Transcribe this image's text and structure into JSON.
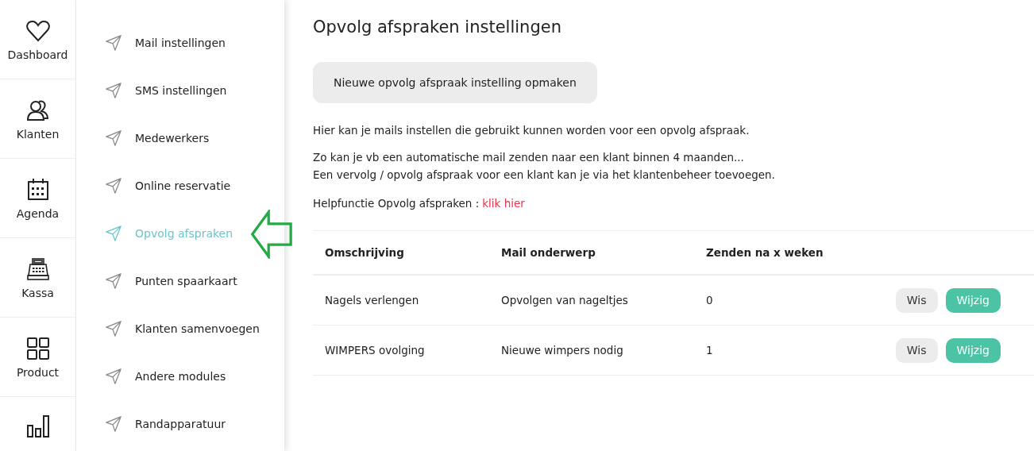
{
  "nav": [
    {
      "label": "Dashboard"
    },
    {
      "label": "Klanten"
    },
    {
      "label": "Agenda"
    },
    {
      "label": "Kassa"
    },
    {
      "label": "Product"
    }
  ],
  "settings_menu": [
    {
      "label": "Mail instellingen",
      "selected": false
    },
    {
      "label": "SMS instellingen",
      "selected": false
    },
    {
      "label": "Medewerkers",
      "selected": false
    },
    {
      "label": "Online reservatie",
      "selected": false
    },
    {
      "label": "Opvolg afspraken",
      "selected": true
    },
    {
      "label": "Punten spaarkaart",
      "selected": false
    },
    {
      "label": "Klanten samenvoegen",
      "selected": false
    },
    {
      "label": "Andere modules",
      "selected": false
    },
    {
      "label": "Randapparatuur",
      "selected": false
    }
  ],
  "page": {
    "title": "Opvolg afspraken instellingen",
    "new_button": "Nieuwe opvolg afspraak instelling opmaken",
    "intro": "Hier kan je mails instellen die gebruikt kunnen worden voor een opvolg afspraak.",
    "details": [
      "Zo kan je vb een automatische mail zenden naar een klant binnen 4 maanden...",
      "Een vervolg / opvolg afspraak voor een klant kan je via het klantenbeheer toevoegen."
    ],
    "help_label": "Helpfunctie Opvolg afspraken :",
    "help_link": "klik hier"
  },
  "table": {
    "columns": [
      "Omschrijving",
      "Mail onderwerp",
      "Zenden na x weken"
    ],
    "rows": [
      {
        "cells": [
          "Nagels verlengen",
          "Opvolgen van nageltjes",
          "0"
        ],
        "delete": "Wis",
        "edit": "Wijzig"
      },
      {
        "cells": [
          "WIMPERS ovolging",
          "Nieuwe wimpers nodig",
          "1"
        ],
        "delete": "Wis",
        "edit": "Wijzig"
      }
    ]
  }
}
